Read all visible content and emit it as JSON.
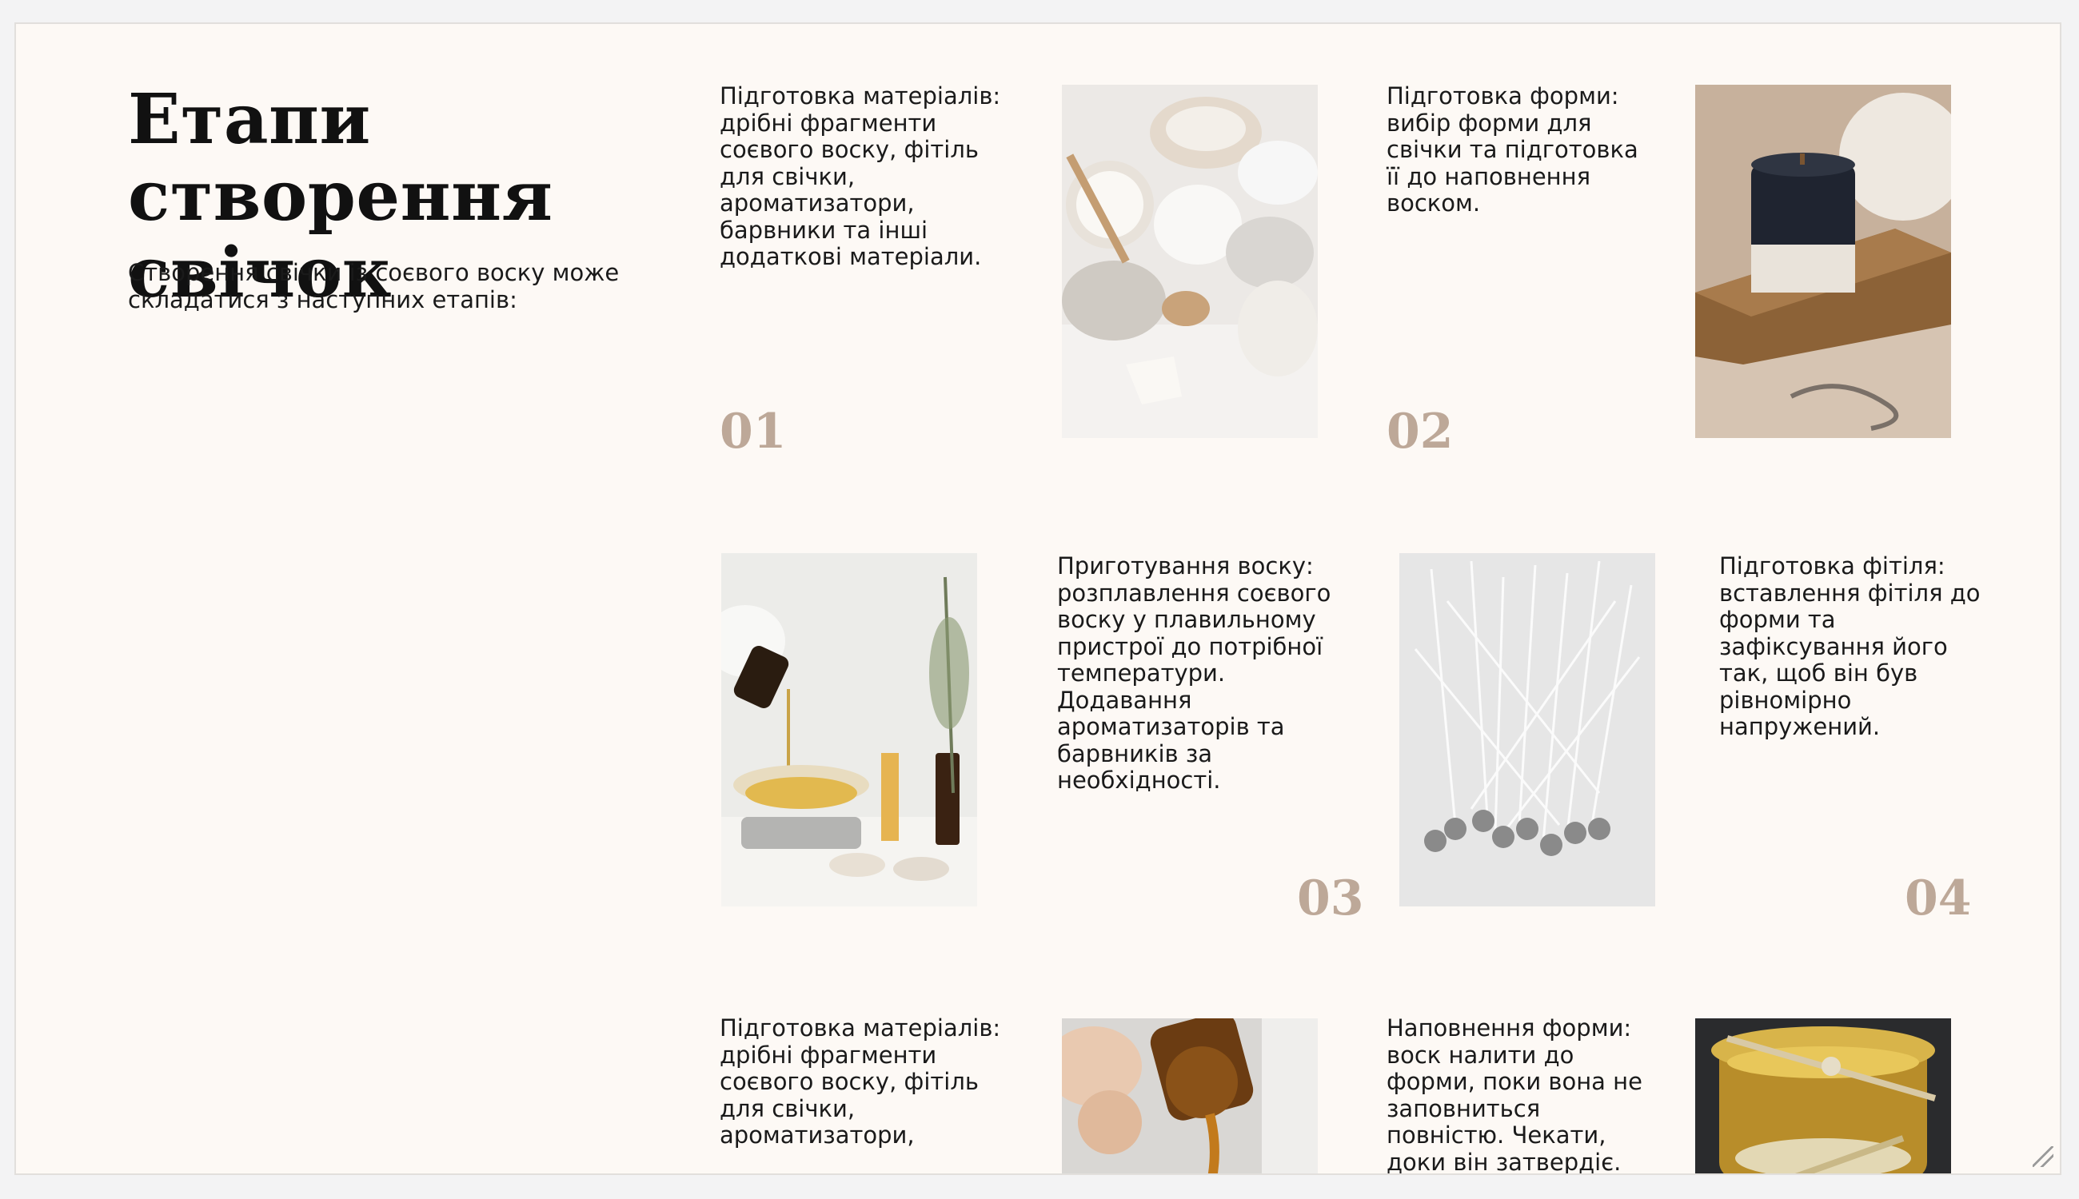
{
  "title": "Етапи створення свічок",
  "intro": "Створення свічки із соєвого воску може складатися з наступних етапів:",
  "steps": [
    {
      "number": "01",
      "text": "Підготовка матеріалів: дрібні фрагменти соєвого воску, фітіль для свічки, ароматизатори, барвники та інші додаткові матеріали.",
      "image_icon": "soy-wax-materials-photo"
    },
    {
      "number": "02",
      "text": "Підготовка форми: вибір форми для свічки та підготовка її до наповнення воском.",
      "image_icon": "candle-jar-on-board-photo"
    },
    {
      "number": "03",
      "text": "Приготування воску: розплавлення соєвого воску у плавильному пристрої до потрібної температури. Додавання ароматизаторів та барвників за необхідності.",
      "image_icon": "pouring-oil-on-scale-photo"
    },
    {
      "number": "04",
      "text": "Підготовка фітіля: вставлення фітіля до форми та зафіксування його так, щоб він був рівномірно напружений.",
      "image_icon": "candle-wicks-photo"
    },
    {
      "number": "",
      "text": "Підготовка матеріалів: дрібні фрагменти соєвого воску, фітіль для свічки, ароматизатори,",
      "image_icon": "dripping-honey-bottle-photo"
    },
    {
      "number": "",
      "text": "Наповнення форми: воск налити до форми, поки вона не заповниться повністю. Чекати, доки він затвердіє.",
      "image_icon": "wax-filled-jar-photo"
    }
  ],
  "colors": {
    "background": "#fdf9f5",
    "accent_numbers": "#bda898",
    "text": "#1a1a1a"
  }
}
